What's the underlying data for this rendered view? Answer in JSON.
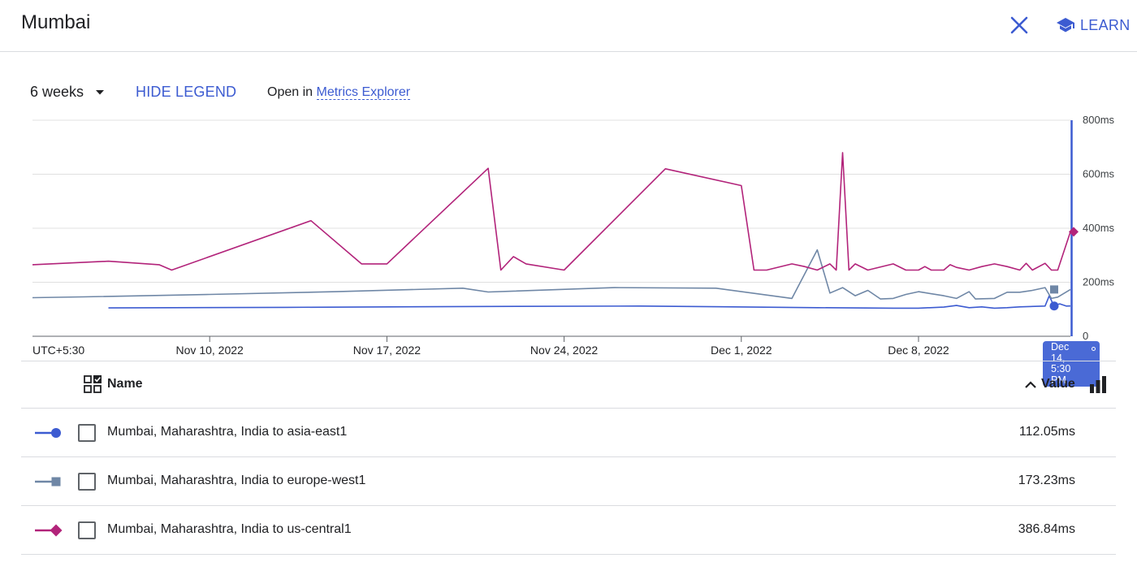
{
  "header": {
    "title": "Mumbai",
    "learn_label": "LEARN"
  },
  "toolbar": {
    "range_label": "6 weeks",
    "hide_legend_label": "HIDE LEGEND",
    "open_in_prefix": "Open in",
    "metrics_link_label": "Metrics Explorer"
  },
  "chart_data": {
    "type": "line",
    "timezone_label": "UTC+5:30",
    "x_ticks": [
      "Nov 10, 2022",
      "Nov 17, 2022",
      "Nov 24, 2022",
      "Dec 1, 2022",
      "Dec 8, 2022"
    ],
    "y_ticks": [
      "800ms",
      "600ms",
      "400ms",
      "200ms",
      "0"
    ],
    "ylim": [
      0,
      800
    ],
    "y_unit": "ms",
    "grid": true,
    "x_start": "2022-11-03",
    "x_end": "2022-12-14",
    "series": [
      {
        "name": "Mumbai, Maharashtra, India to asia-east1",
        "color": "#3c5bd1",
        "marker": "circle",
        "points": [
          [
            "2022-11-06",
            105
          ],
          [
            "2022-11-13",
            107
          ],
          [
            "2022-11-20",
            110
          ],
          [
            "2022-11-27",
            112
          ],
          [
            "2022-12-04",
            106
          ],
          [
            "2022-12-07",
            104
          ],
          [
            "2022-12-08",
            104
          ],
          [
            "2022-12-09",
            108
          ],
          [
            "2022-12-09T12:00",
            114
          ],
          [
            "2022-12-10",
            106
          ],
          [
            "2022-12-10T12:00",
            109
          ],
          [
            "2022-12-11",
            104
          ],
          [
            "2022-12-11T12:00",
            106
          ],
          [
            "2022-12-12",
            109
          ],
          [
            "2022-12-13",
            112
          ],
          [
            "2022-12-13T04:00",
            150
          ],
          [
            "2022-12-13T08:00",
            115
          ],
          [
            "2022-12-13T14:00",
            120
          ],
          [
            "2022-12-13T20:00",
            112
          ],
          [
            "2022-12-14",
            112.05
          ]
        ]
      },
      {
        "name": "Mumbai, Maharashtra, India to europe-west1",
        "color": "#6f87a6",
        "marker": "square",
        "points": [
          [
            "2022-11-03",
            143
          ],
          [
            "2022-11-05",
            146
          ],
          [
            "2022-11-10",
            155
          ],
          [
            "2022-11-15",
            165
          ],
          [
            "2022-11-20",
            178
          ],
          [
            "2022-11-21",
            164
          ],
          [
            "2022-11-26",
            180
          ],
          [
            "2022-11-30",
            178
          ],
          [
            "2022-12-03",
            140
          ],
          [
            "2022-12-04",
            320
          ],
          [
            "2022-12-04T12:00",
            160
          ],
          [
            "2022-12-05",
            180
          ],
          [
            "2022-12-05T12:00",
            150
          ],
          [
            "2022-12-06",
            170
          ],
          [
            "2022-12-06T12:00",
            138
          ],
          [
            "2022-12-07",
            140
          ],
          [
            "2022-12-07T12:00",
            155
          ],
          [
            "2022-12-08",
            165
          ],
          [
            "2022-12-09",
            150
          ],
          [
            "2022-12-09T12:00",
            140
          ],
          [
            "2022-12-10",
            165
          ],
          [
            "2022-12-10T06:00",
            138
          ],
          [
            "2022-12-11",
            140
          ],
          [
            "2022-12-11T12:00",
            163
          ],
          [
            "2022-12-12",
            163
          ],
          [
            "2022-12-12T12:00",
            170
          ],
          [
            "2022-12-13",
            180
          ],
          [
            "2022-12-13T06:00",
            140
          ],
          [
            "2022-12-13T12:00",
            145
          ],
          [
            "2022-12-14",
            173.23
          ]
        ]
      },
      {
        "name": "Mumbai, Maharashtra, India to us-central1",
        "color": "#b2237a",
        "marker": "diamond",
        "points": [
          [
            "2022-11-03",
            265
          ],
          [
            "2022-11-06",
            278
          ],
          [
            "2022-11-08",
            265
          ],
          [
            "2022-11-08T12:00",
            245
          ],
          [
            "2022-11-14",
            428
          ],
          [
            "2022-11-16",
            268
          ],
          [
            "2022-11-17",
            268
          ],
          [
            "2022-11-21",
            622
          ],
          [
            "2022-11-21T12:00",
            245
          ],
          [
            "2022-11-22",
            295
          ],
          [
            "2022-11-22T12:00",
            268
          ],
          [
            "2022-11-24",
            245
          ],
          [
            "2022-11-28",
            620
          ],
          [
            "2022-12-01",
            558
          ],
          [
            "2022-12-01T12:00",
            245
          ],
          [
            "2022-12-02",
            245
          ],
          [
            "2022-12-03",
            268
          ],
          [
            "2022-12-03T12:00",
            258
          ],
          [
            "2022-12-04",
            245
          ],
          [
            "2022-12-04T12:00",
            268
          ],
          [
            "2022-12-04T18:00",
            245
          ],
          [
            "2022-12-05",
            680
          ],
          [
            "2022-12-05T06:00",
            245
          ],
          [
            "2022-12-05T12:00",
            268
          ],
          [
            "2022-12-06",
            245
          ],
          [
            "2022-12-07",
            268
          ],
          [
            "2022-12-07T12:00",
            245
          ],
          [
            "2022-12-08",
            245
          ],
          [
            "2022-12-08T06:00",
            258
          ],
          [
            "2022-12-08T12:00",
            245
          ],
          [
            "2022-12-09",
            245
          ],
          [
            "2022-12-09T06:00",
            265
          ],
          [
            "2022-12-09T12:00",
            255
          ],
          [
            "2022-12-10",
            245
          ],
          [
            "2022-12-10T12:00",
            258
          ],
          [
            "2022-12-11",
            268
          ],
          [
            "2022-12-11T12:00",
            258
          ],
          [
            "2022-12-12",
            245
          ],
          [
            "2022-12-12T06:00",
            270
          ],
          [
            "2022-12-12T12:00",
            245
          ],
          [
            "2022-12-13",
            270
          ],
          [
            "2022-12-13T06:00",
            245
          ],
          [
            "2022-12-13T12:00",
            245
          ],
          [
            "2022-12-14",
            386.84
          ]
        ]
      }
    ],
    "cursor_date": "2022-12-14",
    "tooltip_lines": [
      "Dec",
      "14,",
      "5:30",
      "PM"
    ]
  },
  "table": {
    "name_header": "Name",
    "value_header": "Value",
    "rows": [
      {
        "name": "Mumbai, Maharashtra, India to asia-east1",
        "value": "112.05ms",
        "color": "#3c5bd1",
        "marker": "circle"
      },
      {
        "name": "Mumbai, Maharashtra, India to europe-west1",
        "value": "173.23ms",
        "color": "#6f87a6",
        "marker": "square"
      },
      {
        "name": "Mumbai, Maharashtra, India to us-central1",
        "value": "386.84ms",
        "color": "#b2237a",
        "marker": "diamond"
      }
    ]
  }
}
